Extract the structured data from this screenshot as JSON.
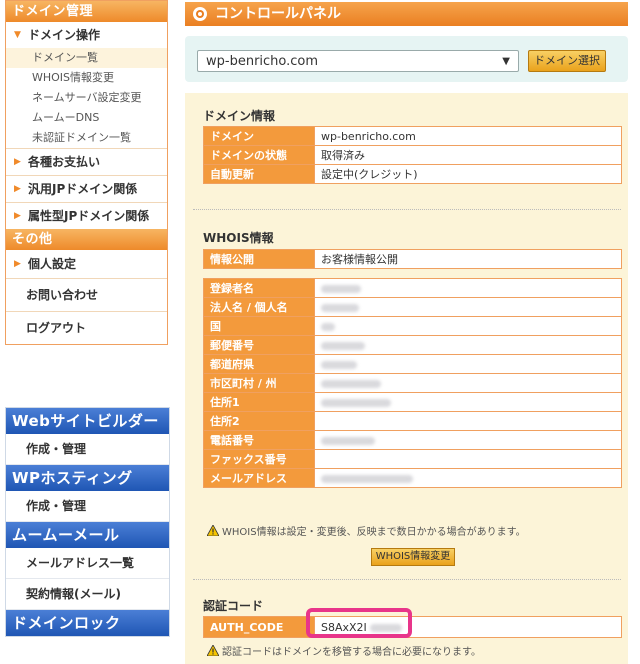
{
  "sidebar": {
    "domain_mgmt_header": "ドメイン管理",
    "domain_ops": "ドメイン操作",
    "sub_items": [
      "ドメイン一覧",
      "WHOIS情報変更",
      "ネームサーバ設定変更",
      "ムームーDNS",
      "未認証ドメイン一覧"
    ],
    "payments": "各種お支払い",
    "jp_general": "汎用JPドメイン関係",
    "jp_attr": "属性型JPドメイン関係",
    "other_header": "その他",
    "personal": "個人設定",
    "contact": "お問い合わせ",
    "logout": "ログアウト"
  },
  "services": {
    "website_builder": "Webサイトビルダー",
    "website_builder_item": "作成・管理",
    "wp_hosting": "WPホスティング",
    "wp_hosting_item": "作成・管理",
    "mumu_mail": "ムームーメール",
    "mail_list": "メールアドレス一覧",
    "mail_contract": "契約情報(メール)",
    "domain_lock": "ドメインロック"
  },
  "main": {
    "title": "コントロールパネル",
    "selected_domain": "wp-benricho.com",
    "select_button": "ドメイン選択"
  },
  "domain_info": {
    "title": "ドメイン情報",
    "rows": [
      {
        "k": "ドメイン",
        "v": "wp-benricho.com"
      },
      {
        "k": "ドメインの状態",
        "v": "取得済み"
      },
      {
        "k": "自動更新",
        "v": "設定中(クレジット)"
      }
    ]
  },
  "whois": {
    "title": "WHOIS情報",
    "public_label": "情報公開",
    "public_value": "お客様情報公開",
    "fields": [
      "登録者名",
      "法人名 / 個人名",
      "国",
      "郵便番号",
      "都道府県",
      "市区町村 / 州",
      "住所1",
      "住所2",
      "電話番号",
      "ファックス番号",
      "メールアドレス"
    ],
    "note": "WHOIS情報は設定・変更後、反映まで数日かかる場合があります。",
    "change_button": "WHOIS情報変更"
  },
  "auth": {
    "title": "認証コード",
    "label": "AUTH_CODE",
    "value": "S8AxX2I",
    "note": "認証コードはドメインを移管する場合に必要になります。"
  },
  "colors": {
    "orange": "#f39a3c",
    "blue": "#1f56b4",
    "highlight": "#e8358a",
    "panel": "#fcf4d8"
  }
}
